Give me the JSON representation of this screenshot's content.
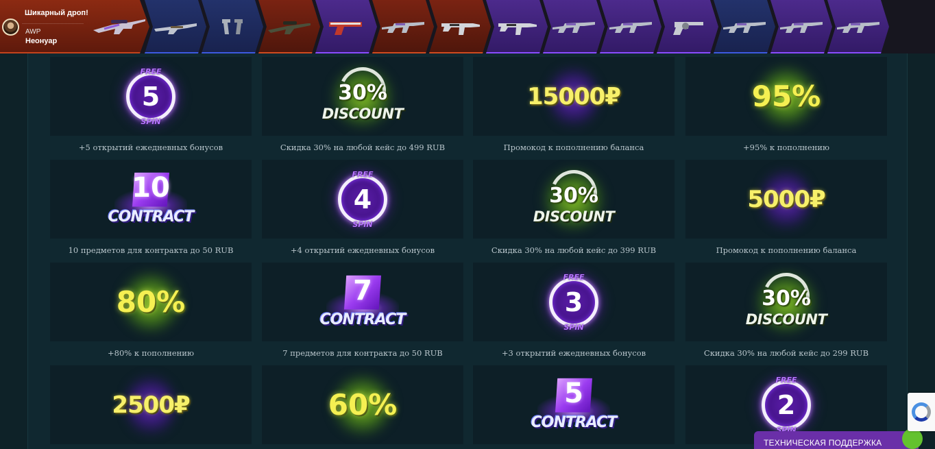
{
  "drop_strip": {
    "featured": {
      "title": "Шикарный дроп!",
      "weapon": "AWP",
      "skin": "Неонуар"
    },
    "items": [
      {
        "color": "blue",
        "icon": "shotgun-icon"
      },
      {
        "color": "blue",
        "icon": "dual-pistols-icon"
      },
      {
        "color": "red",
        "icon": "sniper-rifle-icon"
      },
      {
        "color": "purple",
        "icon": "pistol-icon"
      },
      {
        "color": "red",
        "icon": "rifle-icon"
      },
      {
        "color": "red",
        "icon": "smg-icon"
      },
      {
        "color": "purple",
        "icon": "smg-icon"
      },
      {
        "color": "purple",
        "icon": "rifle-icon"
      },
      {
        "color": "purple",
        "icon": "rifle-icon"
      },
      {
        "color": "purple",
        "icon": "revolver-icon"
      },
      {
        "color": "blue",
        "icon": "rifle-icon"
      },
      {
        "color": "purple",
        "icon": "rifle-icon"
      },
      {
        "color": "purple",
        "icon": "rifle-icon"
      }
    ]
  },
  "bonuses": [
    {
      "kind": "spin",
      "value": "5",
      "caption": "+5 открытий ежедневных бонусов"
    },
    {
      "kind": "discount",
      "value": "30%",
      "caption": "Скидка 30% на любой кейс до 499 RUB"
    },
    {
      "kind": "money",
      "value": "15000₽",
      "caption": "Промокод к пополнению баланса"
    },
    {
      "kind": "percent",
      "value": "95%",
      "caption": "+95% к пополнению"
    },
    {
      "kind": "contract",
      "value": "10",
      "caption": "10 предметов для контракта до 50 RUB"
    },
    {
      "kind": "spin",
      "value": "4",
      "caption": "+4 открытий ежедневных бонусов"
    },
    {
      "kind": "discount",
      "value": "30%",
      "caption": "Скидка 30% на любой кейс до 399 RUB"
    },
    {
      "kind": "money",
      "value": "5000₽",
      "caption": "Промокод к пополнению баланса"
    },
    {
      "kind": "percent",
      "value": "80%",
      "caption": "+80% к пополнению"
    },
    {
      "kind": "contract",
      "value": "7",
      "caption": "7 предметов для контракта до 50 RUB"
    },
    {
      "kind": "spin",
      "value": "3",
      "caption": "+3 открытий ежедневных бонусов"
    },
    {
      "kind": "discount",
      "value": "30%",
      "caption": "Скидка 30% на любой кейс до 299 RUB"
    },
    {
      "kind": "money",
      "value": "2500₽",
      "caption": ""
    },
    {
      "kind": "percent",
      "value": "60%",
      "caption": ""
    },
    {
      "kind": "contract",
      "value": "5",
      "caption": ""
    },
    {
      "kind": "spin",
      "value": "2",
      "caption": ""
    }
  ],
  "badge_text": {
    "free": "FREE",
    "spin": "SPIN",
    "discount": "DISCOUNT",
    "contract": "CONTRACT"
  },
  "support": {
    "label": "ТЕХНИЧЕСКАЯ ПОДДЕРЖКА"
  },
  "colors": {
    "page_bg": "#0e2228",
    "card_bg": "#0d1f27",
    "caption": "#b9c6cc",
    "money_yellow": "#f7f06a",
    "spin_purple": "#b776ff",
    "support_purple": "#6a2fa8",
    "support_green": "#63c22e"
  }
}
